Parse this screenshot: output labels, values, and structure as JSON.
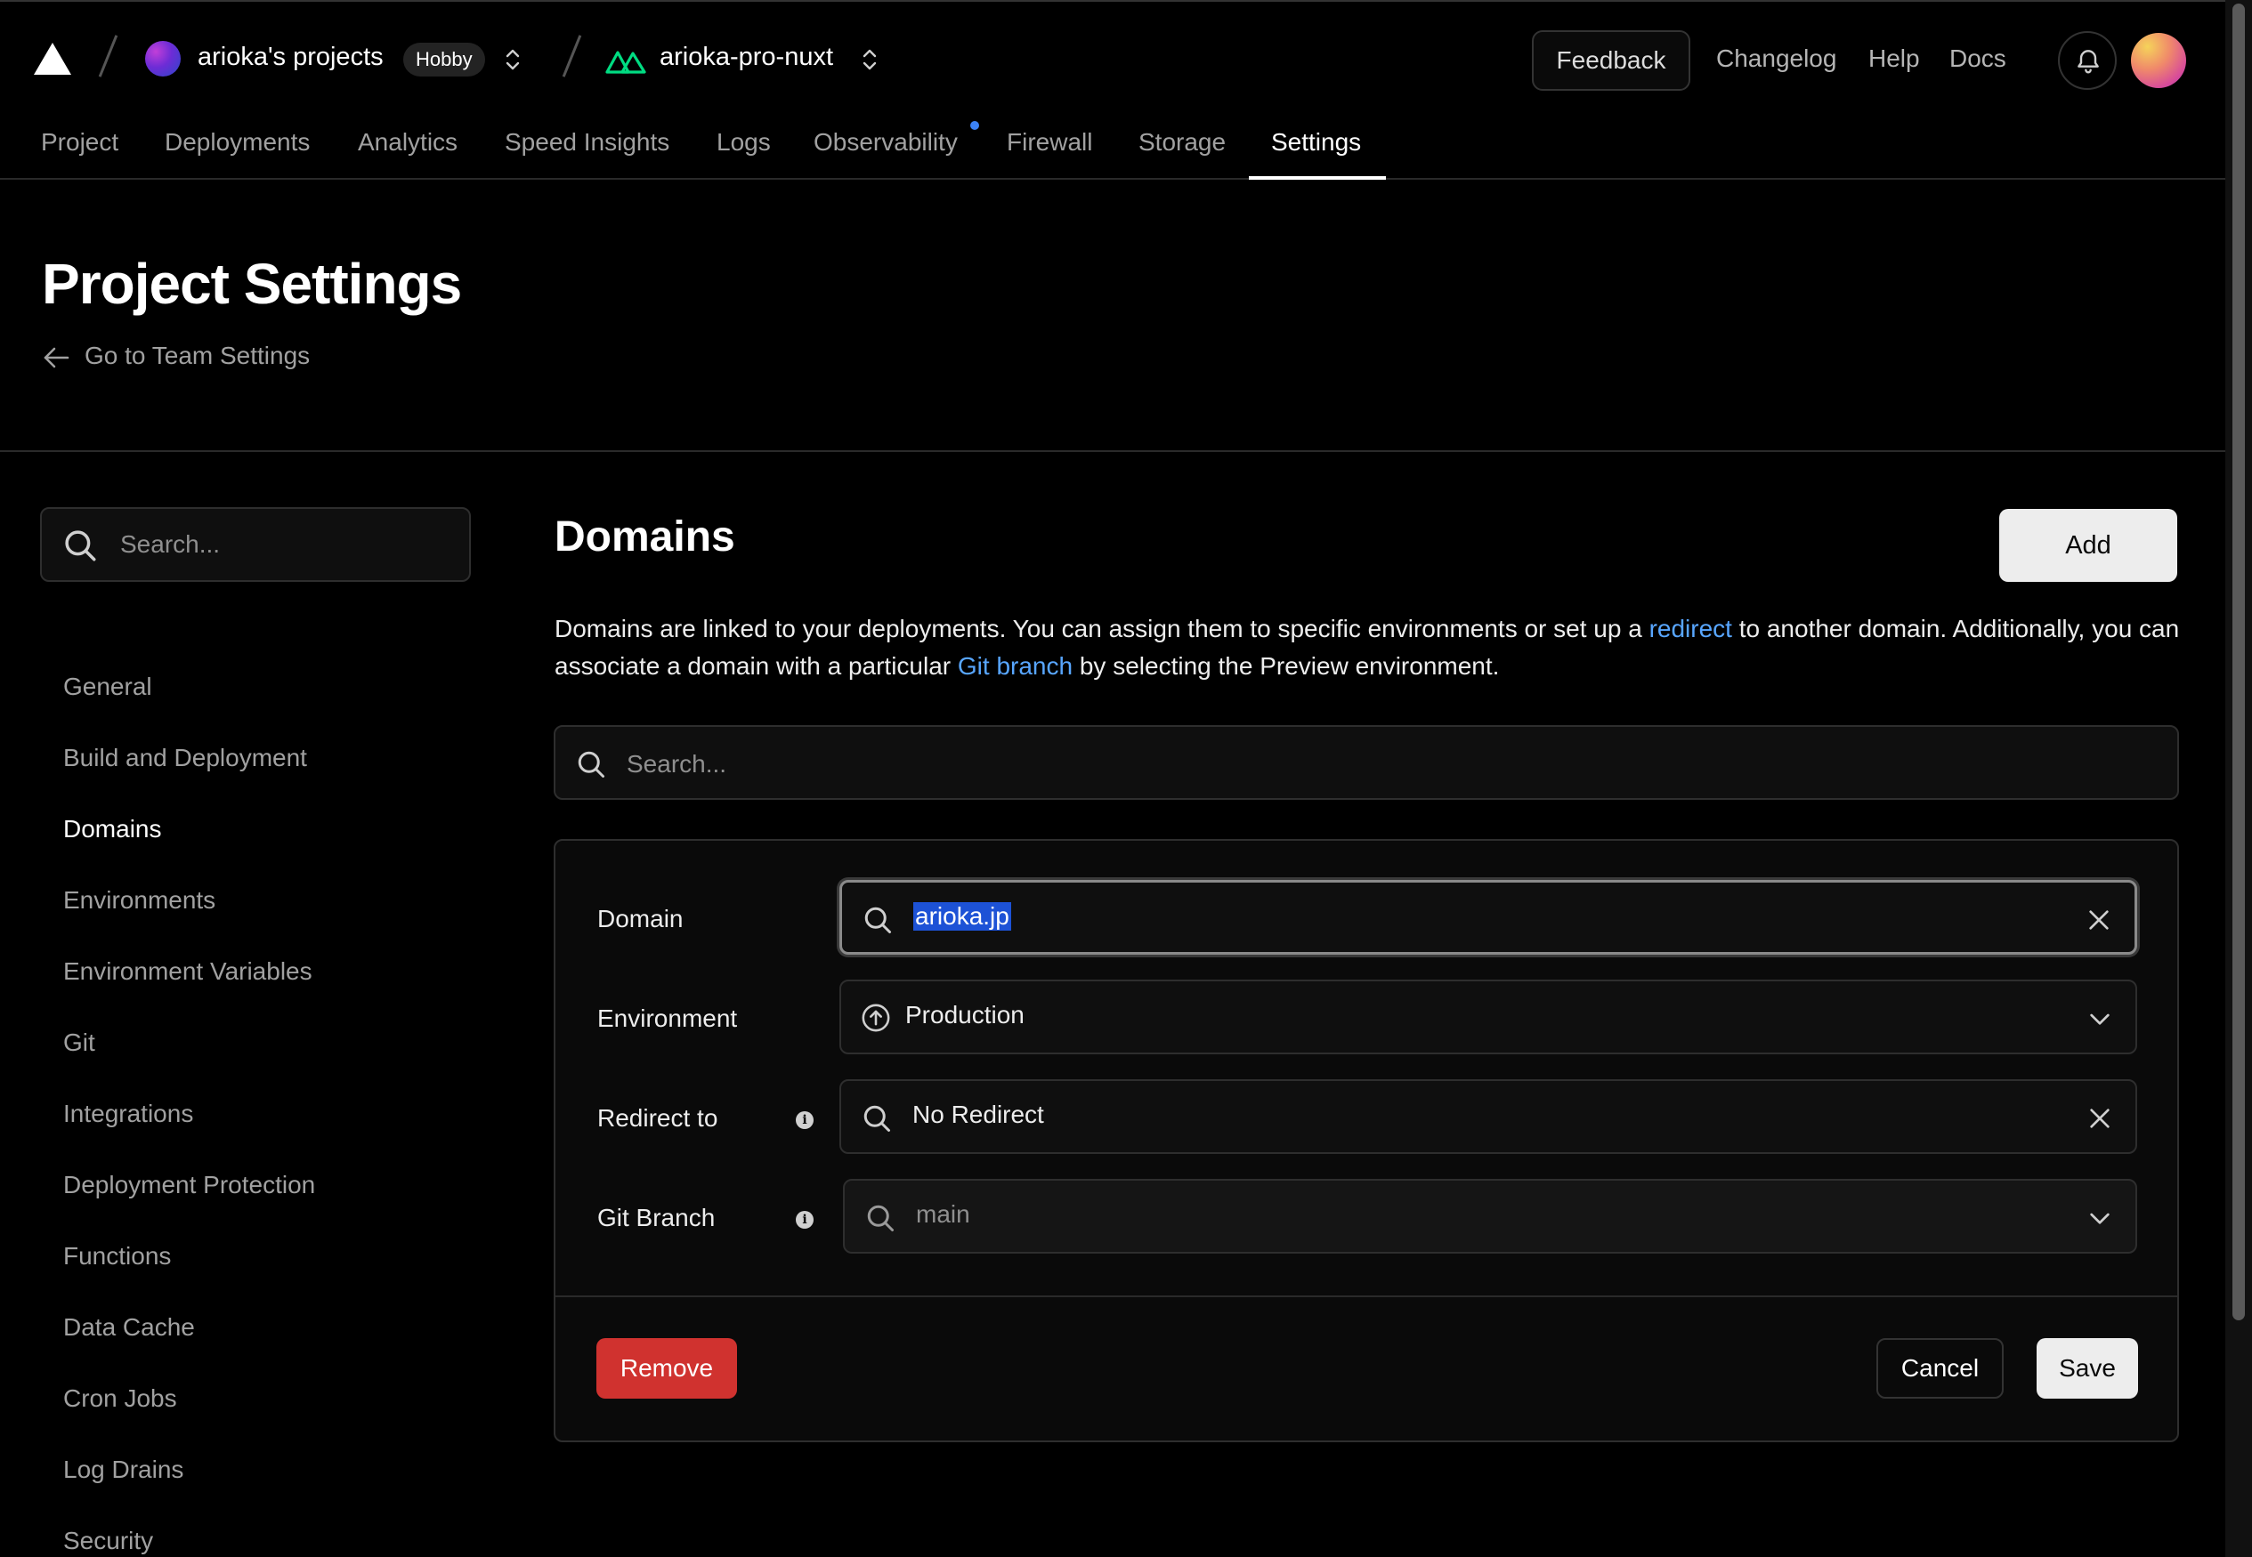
{
  "header": {
    "team_name": "arioka's projects",
    "plan_badge": "Hobby",
    "project_name": "arioka-pro-nuxt",
    "feedback": "Feedback",
    "links": [
      "Changelog",
      "Help",
      "Docs"
    ]
  },
  "nav": {
    "tabs": [
      "Project",
      "Deployments",
      "Analytics",
      "Speed Insights",
      "Logs",
      "Observability",
      "Firewall",
      "Storage",
      "Settings"
    ],
    "active": "Settings"
  },
  "page": {
    "title": "Project Settings",
    "back_link": "Go to Team Settings"
  },
  "sidebar": {
    "search_placeholder": "Search...",
    "items": [
      "General",
      "Build and Deployment",
      "Domains",
      "Environments",
      "Environment Variables",
      "Git",
      "Integrations",
      "Deployment Protection",
      "Functions",
      "Data Cache",
      "Cron Jobs",
      "Log Drains",
      "Security"
    ],
    "active": "Domains"
  },
  "main": {
    "title": "Domains",
    "add_button": "Add",
    "description": {
      "part1": "Domains are linked to your deployments. You can assign them to specific environments or set up a ",
      "link1": "redirect",
      "part2": " to another domain. Additionally, you can associate a domain with a particular ",
      "link2": "Git branch",
      "part3": " by selecting the Preview environment."
    },
    "search_placeholder": "Search..."
  },
  "edit_form": {
    "domain_label": "Domain",
    "domain_value": "arioka.jp",
    "environment_label": "Environment",
    "environment_value": "Production",
    "redirect_label": "Redirect to",
    "redirect_value": "No Redirect",
    "branch_label": "Git Branch",
    "branch_placeholder": "main",
    "remove": "Remove",
    "cancel": "Cancel",
    "save": "Save"
  },
  "colors": {
    "background": "#000000",
    "link": "#58a6ff",
    "danger": "#d0322f",
    "selection": "#1d52d6",
    "nuxt_green": "#00dc82"
  }
}
